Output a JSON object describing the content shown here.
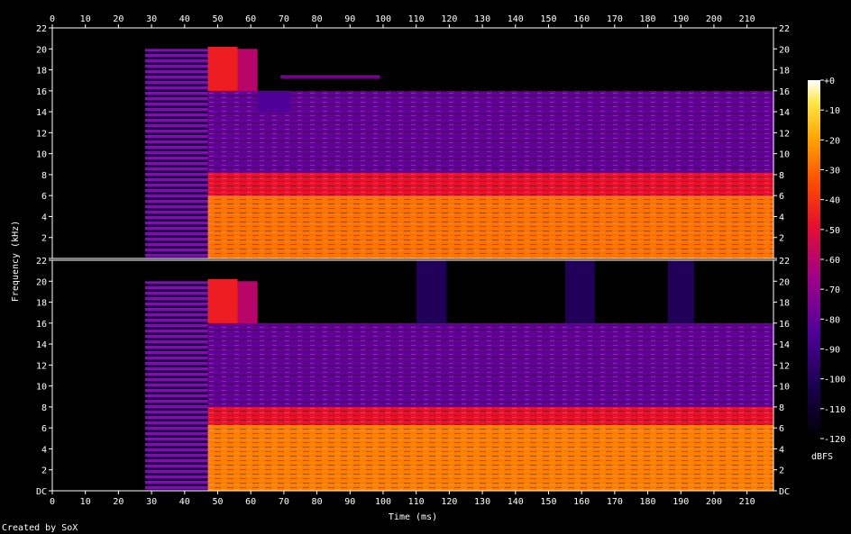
{
  "chart_data": {
    "type": "heatmap",
    "title": "",
    "xlabel": "Time (ms)",
    "ylabel": "Frequency (kHz)",
    "x_ticks": [
      0,
      10,
      20,
      30,
      40,
      50,
      60,
      70,
      80,
      90,
      100,
      110,
      120,
      130,
      140,
      150,
      160,
      170,
      180,
      190,
      200,
      210
    ],
    "xlim": [
      0,
      218
    ],
    "ylim": [
      0,
      22
    ],
    "channels": [
      {
        "y_ticks": [
          "",
          "2",
          "4",
          "6",
          "8",
          "10",
          "12",
          "14",
          "16",
          "18",
          "20",
          "22"
        ],
        "y_ticks_right": [
          "",
          "2",
          "4",
          "6",
          "8",
          "10",
          "12",
          "14",
          "16",
          "18",
          "20",
          "22"
        ],
        "regions": [
          {
            "x": [
              28,
              47
            ],
            "y": [
              0,
              20
            ],
            "level": -72,
            "kind": "harmonic-comb"
          },
          {
            "x": [
              47,
              56
            ],
            "y": [
              0,
              20.2
            ],
            "level": -45,
            "kind": "burst"
          },
          {
            "x": [
              56,
              62
            ],
            "y": [
              0,
              20
            ],
            "level": -60,
            "kind": "burst-tail"
          },
          {
            "x": [
              47,
              218
            ],
            "y": [
              0,
              6
            ],
            "level": -28,
            "kind": "low-band"
          },
          {
            "x": [
              47,
              218
            ],
            "y": [
              6,
              8.2
            ],
            "level": -48,
            "kind": "mid-band"
          },
          {
            "x": [
              47,
              218
            ],
            "y": [
              8.2,
              16
            ],
            "level": -80,
            "kind": "high-band"
          },
          {
            "x": [
              62,
              72
            ],
            "y": [
              14,
              16
            ],
            "level": -85,
            "kind": "edge"
          },
          {
            "x": [
              69,
              99
            ],
            "y": [
              17.2,
              17.5
            ],
            "level": -75,
            "kind": "tone"
          }
        ]
      },
      {
        "y_ticks": [
          "DC",
          "2",
          "4",
          "6",
          "8",
          "10",
          "12",
          "14",
          "16",
          "18",
          "20",
          "22"
        ],
        "y_ticks_right": [
          "DC",
          "2",
          "4",
          "6",
          "8",
          "10",
          "12",
          "14",
          "16",
          "18",
          "20",
          "22"
        ],
        "regions": [
          {
            "x": [
              28,
              47
            ],
            "y": [
              0,
              20
            ],
            "level": -72,
            "kind": "harmonic-comb"
          },
          {
            "x": [
              47,
              56
            ],
            "y": [
              0,
              20.2
            ],
            "level": -45,
            "kind": "burst"
          },
          {
            "x": [
              56,
              62
            ],
            "y": [
              0,
              20
            ],
            "level": -60,
            "kind": "burst-tail"
          },
          {
            "x": [
              47,
              218
            ],
            "y": [
              0,
              6.3
            ],
            "level": -26,
            "kind": "low-band"
          },
          {
            "x": [
              47,
              218
            ],
            "y": [
              6.3,
              8
            ],
            "level": -48,
            "kind": "mid-band"
          },
          {
            "x": [
              47,
              218
            ],
            "y": [
              8,
              16
            ],
            "level": -80,
            "kind": "high-band"
          },
          {
            "x": [
              110,
              119
            ],
            "y": [
              16,
              22
            ],
            "level": -100,
            "kind": "artifact"
          },
          {
            "x": [
              155,
              164
            ],
            "y": [
              16,
              22
            ],
            "level": -100,
            "kind": "artifact"
          },
          {
            "x": [
              186,
              194
            ],
            "y": [
              16,
              22
            ],
            "level": -100,
            "kind": "artifact"
          }
        ]
      }
    ],
    "colorbar": {
      "label": "dBFS",
      "ticks": [
        "+0",
        "-10",
        "-20",
        "-30",
        "-40",
        "-50",
        "-60",
        "-70",
        "-80",
        "-90",
        "-100",
        "-110",
        "-120"
      ],
      "range": [
        -120,
        0
      ]
    }
  },
  "footer": {
    "credit": "Created by SoX"
  }
}
